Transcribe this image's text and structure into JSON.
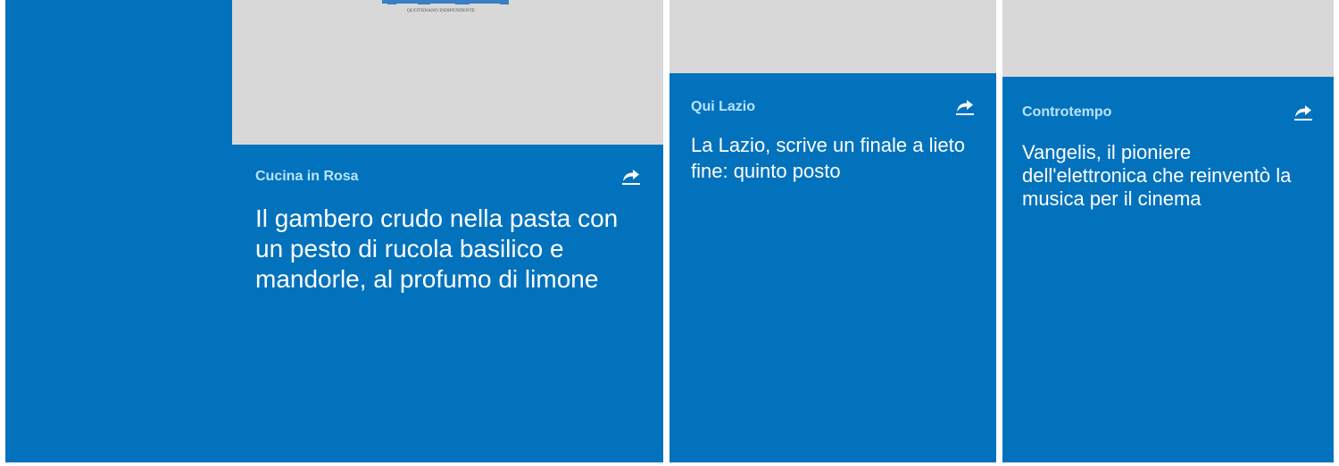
{
  "colors": {
    "card_background": "#0372bd",
    "image_placeholder": "#d8d8d8",
    "category_text": "#b9e3ff",
    "headline_text": "#ffffff"
  },
  "cards": [
    {
      "category": "Cucina in Rosa",
      "headline": "Il gambero crudo nella pasta con un pesto di rucola basilico e mandorle, al profumo di limone",
      "share_icon": "share-arrow-icon",
      "logo_text": "QUOTIDIANO INDIPENDENTE"
    },
    {
      "category": "Qui Lazio",
      "headline": "La Lazio, scrive un finale a lieto fine: quinto posto",
      "share_icon": "share-arrow-icon"
    },
    {
      "category": "Controtempo",
      "headline": "Vangelis, il pioniere dell'elettronica che reinventò la musica per il cinema",
      "share_icon": "share-arrow-icon"
    }
  ]
}
